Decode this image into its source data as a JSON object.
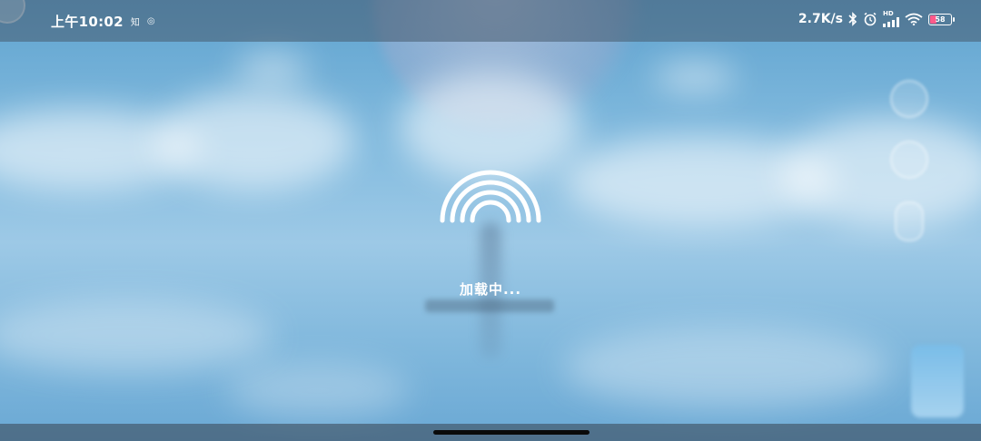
{
  "status_bar": {
    "time": "上午10:02",
    "notification_icons": [
      "zhihu-icon",
      "weibo-icon"
    ],
    "net_speed": "2.7K/s",
    "hd_label": "HD",
    "battery_level": "58",
    "right_icons": [
      "bluetooth-icon",
      "alarm-icon",
      "signal-icon",
      "wifi-icon",
      "battery-icon"
    ]
  },
  "loading": {
    "text": "加载中..."
  },
  "colors": {
    "sky_top": "#5fa3cf",
    "sky_mid": "#9dc9e6",
    "status_bar": "#465a6e",
    "battery_accent": "#ff5a8a"
  }
}
